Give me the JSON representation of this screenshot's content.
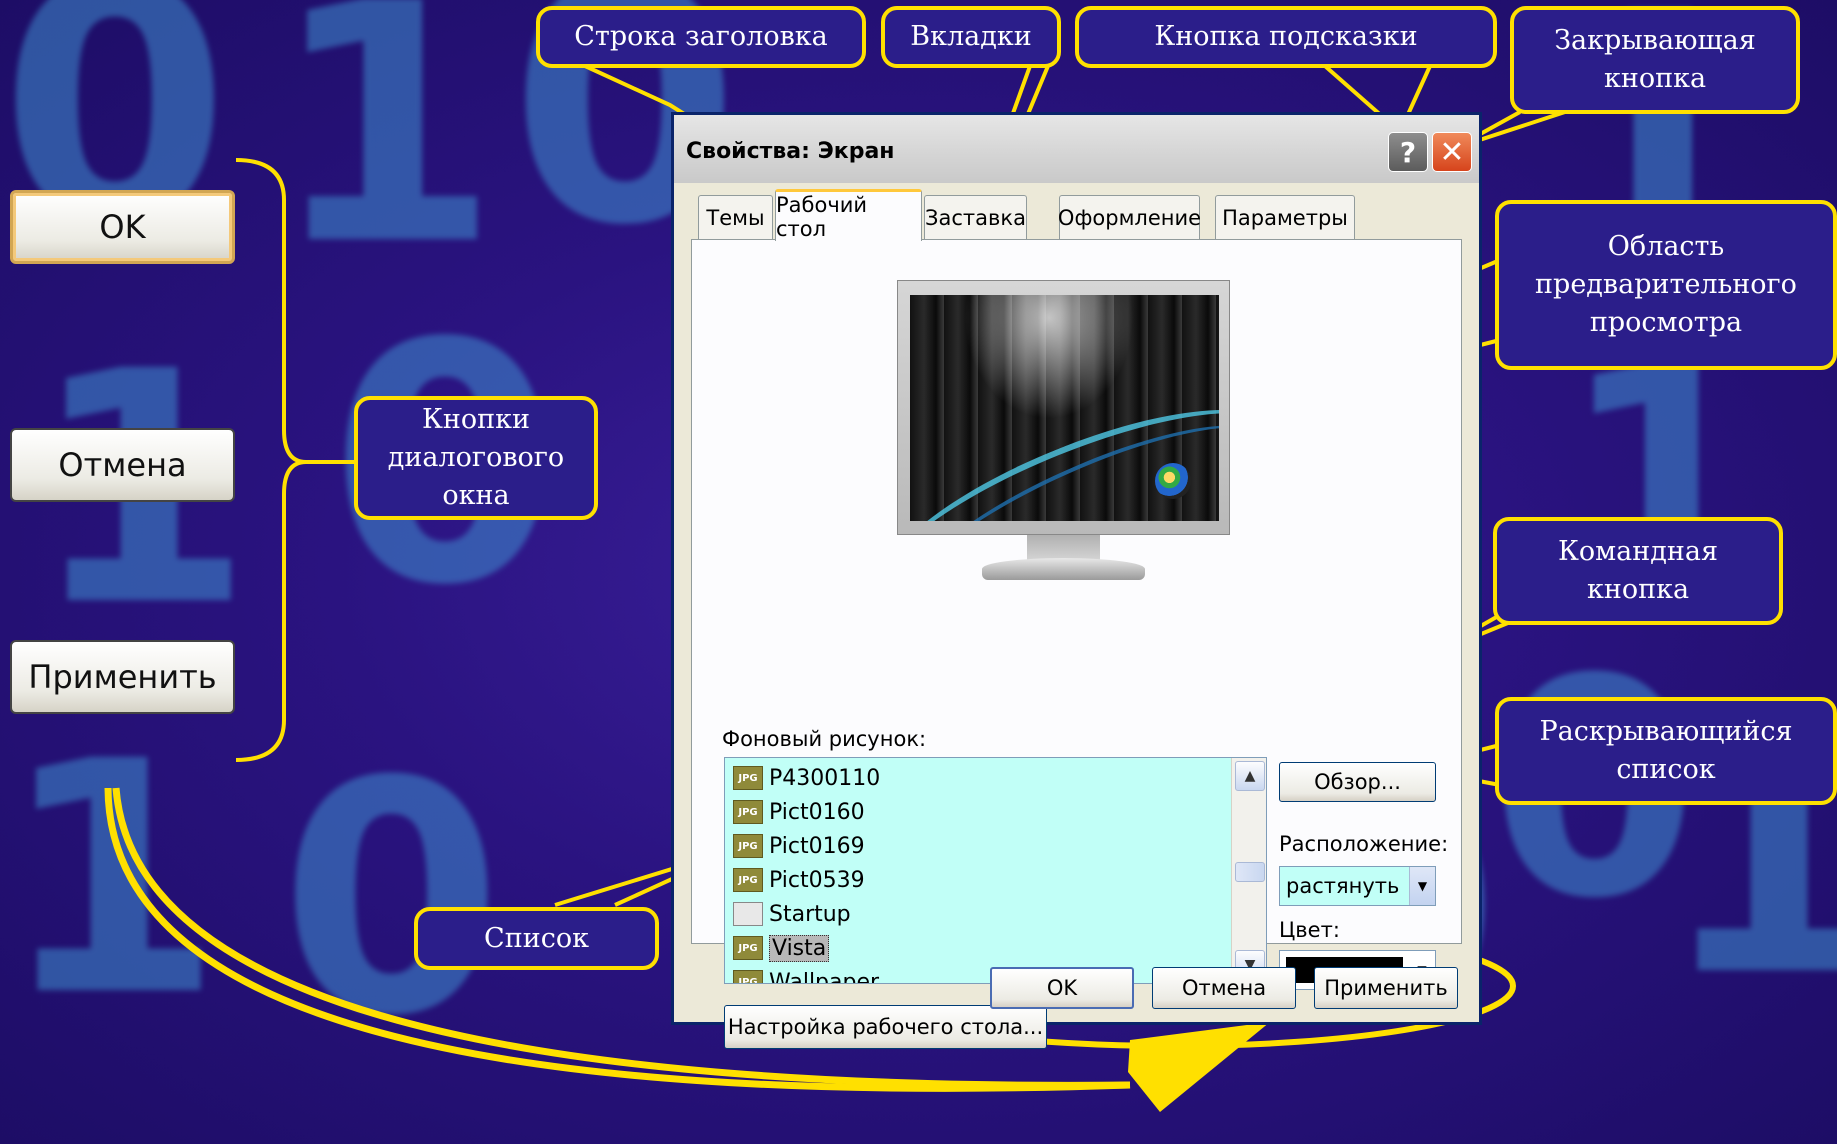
{
  "colors": {
    "accent": "#ffe000",
    "background": "#2a1380",
    "listbox": "#c1fff7"
  },
  "background_digits": [
    "0",
    "1",
    "0",
    "1",
    "1",
    "0",
    "1",
    "0",
    "1",
    "0",
    "1",
    "0"
  ],
  "sample_buttons": {
    "ok": "OK",
    "cancel": "Отмена",
    "apply": "Применить"
  },
  "callouts": {
    "title_bar": "Строка заголовка",
    "tabs": "Вкладки",
    "help_button": "Кнопка подсказки",
    "close_button": [
      "Закрывающая",
      "кнопка"
    ],
    "preview_area": [
      "Область",
      "предварительного",
      "просмотра"
    ],
    "dialog_buttons": [
      "Кнопки",
      "диалогового",
      "окна"
    ],
    "command_button": [
      "Командная",
      "кнопка"
    ],
    "dropdown_list": [
      "Раскрывающийся",
      "список"
    ],
    "list": "Список"
  },
  "dialog": {
    "title": "Свойства: Экран",
    "help_glyph": "?",
    "close_glyph": "✕",
    "tabs": [
      "Темы",
      "Рабочий стол",
      "Заставка",
      "Оформление",
      "Параметры"
    ],
    "active_tab": "Рабочий стол",
    "background_label": "Фоновый рисунок:",
    "files": [
      {
        "name": "P4300110",
        "icon": "jpg-icon"
      },
      {
        "name": "Pict0160",
        "icon": "jpg-icon"
      },
      {
        "name": "Pict0169",
        "icon": "jpg-icon"
      },
      {
        "name": "Pict0539",
        "icon": "jpg-icon"
      },
      {
        "name": "Startup",
        "icon": "system-file-icon"
      },
      {
        "name": "Vista",
        "icon": "jpg-icon",
        "selected": true
      },
      {
        "name": "Wallpaper",
        "icon": "jpg-icon"
      }
    ],
    "file_icon_label": "JPG",
    "browse_button": "Обзор...",
    "position_label": "Расположение:",
    "position_value": "растянуть",
    "color_label": "Цвет:",
    "customize_button": "Настройка рабочего стола...",
    "ok_button": "OK",
    "cancel_button": "Отмена",
    "apply_button": "Применить"
  }
}
